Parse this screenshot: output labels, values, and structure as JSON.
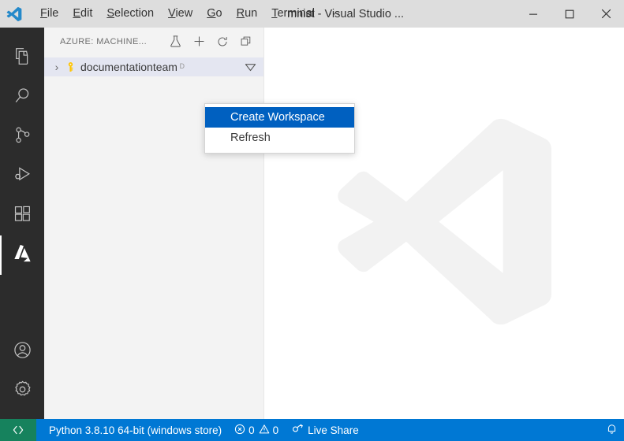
{
  "titlebar": {
    "logo_icon": "vscode-logo-icon",
    "menus": [
      {
        "label": "File",
        "mnemonic": "F"
      },
      {
        "label": "Edit",
        "mnemonic": "E"
      },
      {
        "label": "Selection",
        "mnemonic": "S"
      },
      {
        "label": "View",
        "mnemonic": "V"
      },
      {
        "label": "Go",
        "mnemonic": "G"
      },
      {
        "label": "Run",
        "mnemonic": "R"
      },
      {
        "label": "Terminal",
        "mnemonic": "T"
      }
    ],
    "overflow_label": "⋯",
    "window_title": "mnist - Visual Studio ...",
    "controls": {
      "minimize": "minimize-icon",
      "maximize": "maximize-icon",
      "close": "close-icon"
    }
  },
  "activitybar": {
    "items": [
      {
        "name": "explorer",
        "icon": "files-icon",
        "active": false
      },
      {
        "name": "search",
        "icon": "search-icon",
        "active": false
      },
      {
        "name": "source-control",
        "icon": "source-control-icon",
        "active": false
      },
      {
        "name": "run-and-debug",
        "icon": "run-debug-icon",
        "active": false
      },
      {
        "name": "extensions",
        "icon": "extensions-icon",
        "active": false
      },
      {
        "name": "azure",
        "icon": "azure-icon",
        "active": true
      }
    ],
    "bottom_items": [
      {
        "name": "accounts",
        "icon": "account-icon"
      },
      {
        "name": "manage",
        "icon": "gear-icon"
      }
    ]
  },
  "sidebar": {
    "title": "AZURE: MACHINE...",
    "actions": [
      {
        "name": "experiment",
        "icon": "beaker-icon"
      },
      {
        "name": "create",
        "icon": "plus-icon"
      },
      {
        "name": "refresh",
        "icon": "refresh-icon"
      },
      {
        "name": "split-editor",
        "icon": "split-editor-icon"
      }
    ],
    "tree": {
      "twisty": "›",
      "item_icon": "key-icon",
      "label": "documentationteam",
      "sublabel": "ᴰ",
      "filter_icon": "filter-triangle-icon"
    }
  },
  "context_menu": {
    "items": [
      {
        "label": "Create Workspace",
        "selected": true
      },
      {
        "label": "Refresh",
        "selected": false
      }
    ],
    "highlight_color": "#0060c0"
  },
  "editor": {
    "watermark_icon": "vscode-watermark-logo"
  },
  "statusbar": {
    "remote_icon": "remote-indicator-icon",
    "python_version": "Python 3.8.10 64-bit (windows store)",
    "errors": "0",
    "warnings": "0",
    "error_icon": "error-circle-icon",
    "warning_icon": "warning-triangle-icon",
    "live_share_label": "Live Share",
    "live_share_icon": "live-share-icon",
    "notifications_icon": "bell-icon",
    "background_color": "#0078d4",
    "remote_color": "#16825d"
  }
}
